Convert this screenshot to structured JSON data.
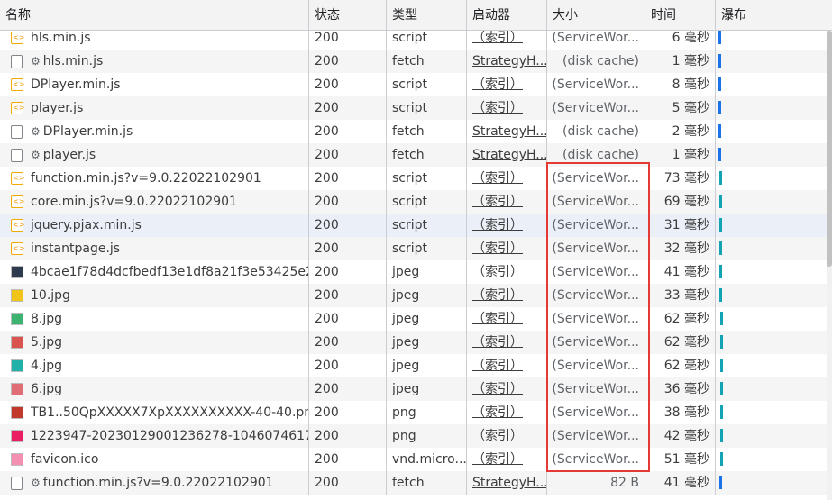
{
  "columns": {
    "name": "名称",
    "status": "状态",
    "type": "类型",
    "initiator": "启动器",
    "size": "大小",
    "time": "时间",
    "waterfall": "瀑布"
  },
  "rows": [
    {
      "name": "hls.min.js",
      "icon": "script-file-icon",
      "status": "200",
      "type": "script",
      "initiator": "（索引）",
      "size": "(ServiceWor...",
      "time": "6 毫秒"
    },
    {
      "name": "hls.min.js",
      "icon": "fetch-request-icon",
      "status": "200",
      "type": "fetch",
      "initiator": "StrategyH...",
      "size": "(disk cache)",
      "time": "1 毫秒"
    },
    {
      "name": "DPlayer.min.js",
      "icon": "script-file-icon",
      "status": "200",
      "type": "script",
      "initiator": "（索引）",
      "size": "(ServiceWor...",
      "time": "8 毫秒"
    },
    {
      "name": "player.js",
      "icon": "script-file-icon",
      "status": "200",
      "type": "script",
      "initiator": "（索引）",
      "size": "(ServiceWor...",
      "time": "5 毫秒"
    },
    {
      "name": "DPlayer.min.js",
      "icon": "fetch-request-icon",
      "status": "200",
      "type": "fetch",
      "initiator": "StrategyH...",
      "size": "(disk cache)",
      "time": "2 毫秒"
    },
    {
      "name": "player.js",
      "icon": "fetch-request-icon",
      "status": "200",
      "type": "fetch",
      "initiator": "StrategyH...",
      "size": "(disk cache)",
      "time": "1 毫秒"
    },
    {
      "name": "function.min.js?v=9.0.22022102901",
      "icon": "script-file-icon",
      "status": "200",
      "type": "script",
      "initiator": "（索引）",
      "size": "(ServiceWor...",
      "time": "73 毫秒"
    },
    {
      "name": "core.min.js?v=9.0.22022102901",
      "icon": "script-file-icon",
      "status": "200",
      "type": "script",
      "initiator": "（索引）",
      "size": "(ServiceWor...",
      "time": "69 毫秒"
    },
    {
      "name": "jquery.pjax.min.js",
      "icon": "script-file-icon",
      "status": "200",
      "type": "script",
      "initiator": "（索引）",
      "size": "(ServiceWor...",
      "time": "31 毫秒"
    },
    {
      "name": "instantpage.js",
      "icon": "script-file-icon",
      "status": "200",
      "type": "script",
      "initiator": "（索引）",
      "size": "(ServiceWor...",
      "time": "32 毫秒"
    },
    {
      "name": "4bcae1f78d4dcfbedf13e1df8a21f3e53425e2...",
      "icon": "image-thumbnail-icon",
      "status": "200",
      "type": "jpeg",
      "initiator": "（索引）",
      "size": "(ServiceWor...",
      "time": "41 毫秒"
    },
    {
      "name": "10.jpg",
      "icon": "image-thumbnail-icon",
      "status": "200",
      "type": "jpeg",
      "initiator": "（索引）",
      "size": "(ServiceWor...",
      "time": "33 毫秒"
    },
    {
      "name": "8.jpg",
      "icon": "image-thumbnail-icon",
      "status": "200",
      "type": "jpeg",
      "initiator": "（索引）",
      "size": "(ServiceWor...",
      "time": "62 毫秒"
    },
    {
      "name": "5.jpg",
      "icon": "image-thumbnail-icon",
      "status": "200",
      "type": "jpeg",
      "initiator": "（索引）",
      "size": "(ServiceWor...",
      "time": "62 毫秒"
    },
    {
      "name": "4.jpg",
      "icon": "image-thumbnail-icon",
      "status": "200",
      "type": "jpeg",
      "initiator": "（索引）",
      "size": "(ServiceWor...",
      "time": "62 毫秒"
    },
    {
      "name": "6.jpg",
      "icon": "image-thumbnail-icon",
      "status": "200",
      "type": "jpeg",
      "initiator": "（索引）",
      "size": "(ServiceWor...",
      "time": "36 毫秒"
    },
    {
      "name": "TB1..50QpXXXXX7XpXXXXXXXXXX-40-40.png",
      "icon": "image-thumbnail-icon",
      "status": "200",
      "type": "png",
      "initiator": "（索引）",
      "size": "(ServiceWor...",
      "time": "38 毫秒"
    },
    {
      "name": "1223947-20230129001236278-1046074617....",
      "icon": "image-thumbnail-icon",
      "status": "200",
      "type": "png",
      "initiator": "（索引）",
      "size": "(ServiceWor...",
      "time": "42 毫秒"
    },
    {
      "name": "favicon.ico",
      "icon": "image-thumbnail-icon",
      "status": "200",
      "type": "vnd.micro...",
      "initiator": "（索引）",
      "size": "(ServiceWor...",
      "time": "51 毫秒"
    },
    {
      "name": "function.min.js?v=9.0.22022102901",
      "icon": "fetch-request-icon",
      "status": "200",
      "type": "fetch",
      "initiator": "StrategyH...",
      "size": "82 B",
      "time": "41 毫秒"
    }
  ],
  "colors": {
    "highlight_border": "#e53935",
    "header_bg": "#f3f3f3",
    "waterfall_blue": "#1a73e8",
    "waterfall_teal": "#12a4b4",
    "script_icon": "#f2a900"
  }
}
